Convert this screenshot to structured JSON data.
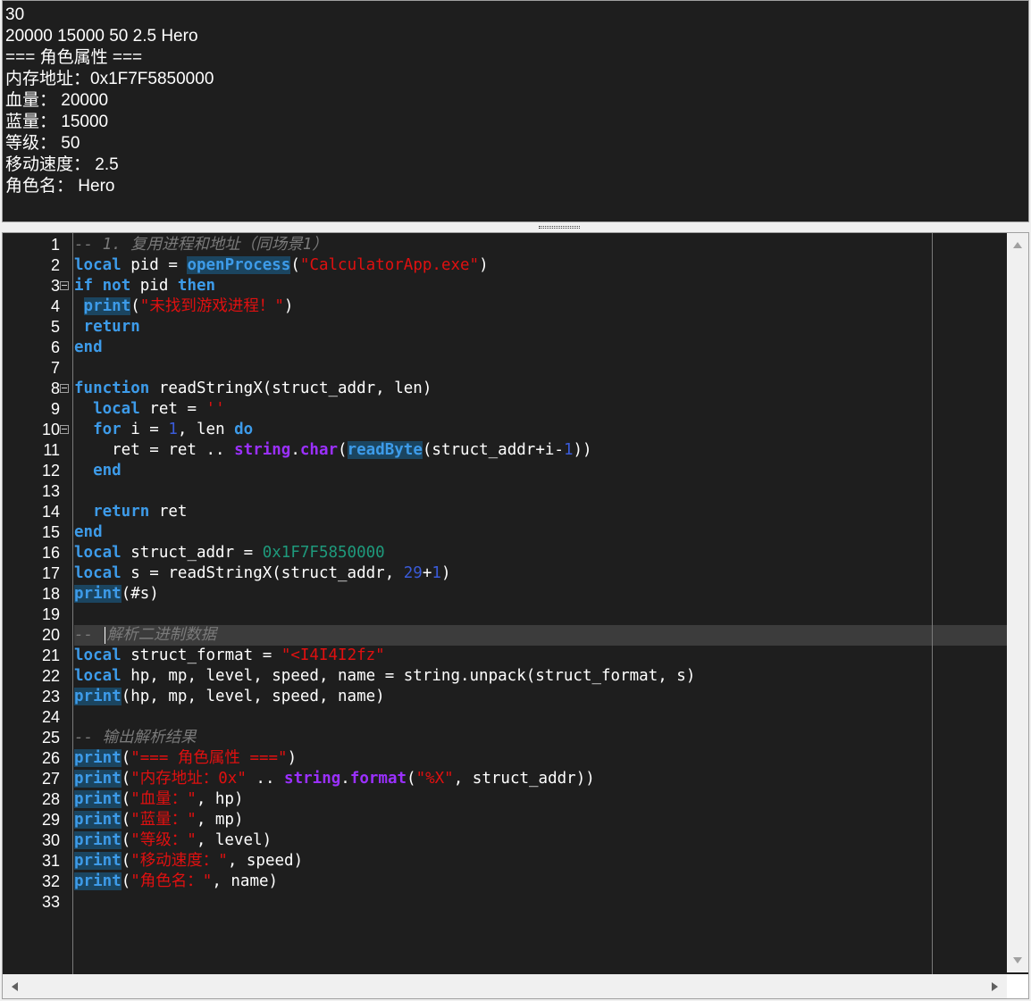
{
  "output": {
    "lines": [
      "30",
      "20000 15000 50 2.5 Hero",
      "=== 角色属性 ===",
      "内存地址：0x1F7F5850000",
      "血量： 20000",
      "蓝量： 15000",
      "等级： 50",
      "移动速度： 2.5",
      "角色名： Hero"
    ]
  },
  "editor": {
    "current_line": 20,
    "fold_markers_at": [
      3,
      8,
      10
    ],
    "lines": [
      [
        {
          "t": "-- 1. 复用进程和地址（同场景1）",
          "c": "cmt"
        }
      ],
      [
        {
          "t": "local",
          "c": "kw"
        },
        {
          "t": " pid = "
        },
        {
          "t": "openProcess",
          "c": "fn"
        },
        {
          "t": "("
        },
        {
          "t": "\"CalculatorApp.exe\"",
          "c": "str"
        },
        {
          "t": ")"
        }
      ],
      [
        {
          "t": "if",
          "c": "kw"
        },
        {
          "t": " "
        },
        {
          "t": "not",
          "c": "kw"
        },
        {
          "t": " pid "
        },
        {
          "t": "then",
          "c": "kw"
        }
      ],
      [
        {
          "t": " "
        },
        {
          "t": "print",
          "c": "fn"
        },
        {
          "t": "("
        },
        {
          "t": "\"未找到游戏进程！\"",
          "c": "str"
        },
        {
          "t": ")"
        }
      ],
      [
        {
          "t": " "
        },
        {
          "t": "return",
          "c": "kw"
        }
      ],
      [
        {
          "t": "end",
          "c": "kw"
        }
      ],
      [],
      [
        {
          "t": "function",
          "c": "kw"
        },
        {
          "t": " readStringX(struct_addr, len)"
        }
      ],
      [
        {
          "t": "  "
        },
        {
          "t": "local",
          "c": "kw"
        },
        {
          "t": " ret = "
        },
        {
          "t": "''",
          "c": "str"
        }
      ],
      [
        {
          "t": "  "
        },
        {
          "t": "for",
          "c": "kw"
        },
        {
          "t": " i = "
        },
        {
          "t": "1",
          "c": "num"
        },
        {
          "t": ", len "
        },
        {
          "t": "do",
          "c": "kw"
        }
      ],
      [
        {
          "t": "    ret = ret .. "
        },
        {
          "t": "string",
          "c": "lib"
        },
        {
          "t": "."
        },
        {
          "t": "char",
          "c": "lib"
        },
        {
          "t": "("
        },
        {
          "t": "readByte",
          "c": "fn"
        },
        {
          "t": "(struct_addr+i-"
        },
        {
          "t": "1",
          "c": "num"
        },
        {
          "t": "))"
        }
      ],
      [
        {
          "t": "  "
        },
        {
          "t": "end",
          "c": "kw"
        }
      ],
      [],
      [
        {
          "t": "  "
        },
        {
          "t": "return",
          "c": "kw"
        },
        {
          "t": " ret"
        }
      ],
      [
        {
          "t": "end",
          "c": "kw"
        }
      ],
      [
        {
          "t": "local",
          "c": "kw"
        },
        {
          "t": " struct_addr = "
        },
        {
          "t": "0x1F7F5850000",
          "c": "hex"
        }
      ],
      [
        {
          "t": "local",
          "c": "kw"
        },
        {
          "t": " s = readStringX(struct_addr, "
        },
        {
          "t": "29",
          "c": "num"
        },
        {
          "t": "+"
        },
        {
          "t": "1",
          "c": "num"
        },
        {
          "t": ")"
        }
      ],
      [
        {
          "t": "print",
          "c": "fn"
        },
        {
          "t": "(#s)"
        }
      ],
      [],
      [
        {
          "t": "-- ",
          "c": "cmt"
        },
        {
          "t": "",
          "c": "caret"
        },
        {
          "t": "解析二进制数据",
          "c": "cmt"
        }
      ],
      [
        {
          "t": "local",
          "c": "kw"
        },
        {
          "t": " struct_format = "
        },
        {
          "t": "\"<I4I4I2fz\"",
          "c": "str"
        }
      ],
      [
        {
          "t": "local",
          "c": "kw"
        },
        {
          "t": " hp, mp, level, speed, name = string.unpack(struct_format, s)"
        }
      ],
      [
        {
          "t": "print",
          "c": "fn"
        },
        {
          "t": "(hp, mp, level, speed, name)"
        }
      ],
      [],
      [
        {
          "t": "-- 输出解析结果",
          "c": "cmt"
        }
      ],
      [
        {
          "t": "print",
          "c": "fn"
        },
        {
          "t": "("
        },
        {
          "t": "\"=== 角色属性 ===\"",
          "c": "str"
        },
        {
          "t": ")"
        }
      ],
      [
        {
          "t": "print",
          "c": "fn"
        },
        {
          "t": "("
        },
        {
          "t": "\"内存地址：0x\"",
          "c": "str"
        },
        {
          "t": " .. "
        },
        {
          "t": "string",
          "c": "lib"
        },
        {
          "t": "."
        },
        {
          "t": "format",
          "c": "lib"
        },
        {
          "t": "("
        },
        {
          "t": "\"%X\"",
          "c": "str"
        },
        {
          "t": ", struct_addr))"
        }
      ],
      [
        {
          "t": "print",
          "c": "fn"
        },
        {
          "t": "("
        },
        {
          "t": "\"血量：\"",
          "c": "str"
        },
        {
          "t": ", hp)"
        }
      ],
      [
        {
          "t": "print",
          "c": "fn"
        },
        {
          "t": "("
        },
        {
          "t": "\"蓝量：\"",
          "c": "str"
        },
        {
          "t": ", mp)"
        }
      ],
      [
        {
          "t": "print",
          "c": "fn"
        },
        {
          "t": "("
        },
        {
          "t": "\"等级：\"",
          "c": "str"
        },
        {
          "t": ", level)"
        }
      ],
      [
        {
          "t": "print",
          "c": "fn"
        },
        {
          "t": "("
        },
        {
          "t": "\"移动速度：\"",
          "c": "str"
        },
        {
          "t": ", speed)"
        }
      ],
      [
        {
          "t": "print",
          "c": "fn"
        },
        {
          "t": "("
        },
        {
          "t": "\"角色名：\"",
          "c": "str"
        },
        {
          "t": ", name)"
        }
      ],
      []
    ]
  },
  "colors": {
    "background": "#1e1e1e",
    "keyword": "#3d9be9",
    "string": "#e01010",
    "number": "#3a5bd9",
    "hex": "#1e9a7c",
    "comment": "#7a7a7a",
    "library": "#9b30ff"
  },
  "icons": [
    "scroll-up-arrow-icon",
    "scroll-down-arrow-icon",
    "scroll-left-arrow-icon",
    "scroll-right-arrow-icon",
    "fold-toggle-icon",
    "splitter-grip-icon"
  ]
}
